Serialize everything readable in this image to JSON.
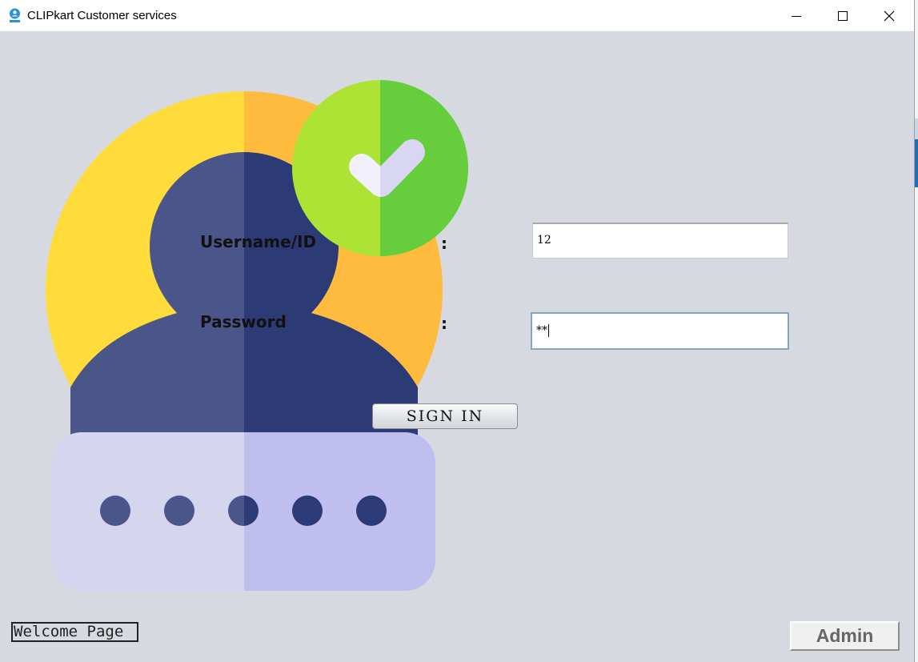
{
  "window": {
    "title": "CLIPkart Customer services",
    "controls": {
      "minimize": "minimize-icon",
      "maximize": "maximize-icon",
      "close": "close-icon"
    }
  },
  "illustration": {
    "icon": "user-verified-password-icon",
    "colors": {
      "yellow": "#ffdc3c",
      "orange": "#ffbb3e",
      "navy": "#4a5589",
      "navy_dark": "#2c3b75",
      "green_light": "#ace334",
      "green": "#66cd3c",
      "panel": "#d6d5f0",
      "panel_dark": "#bfbeee"
    }
  },
  "form": {
    "username_label": "Username/ID",
    "password_label": "Password",
    "colon": ":",
    "username_value": "12",
    "password_value": "**",
    "sign_in_label": "SIGN IN"
  },
  "footer": {
    "welcome_label": "Welcome Page",
    "admin_label": "Admin"
  }
}
